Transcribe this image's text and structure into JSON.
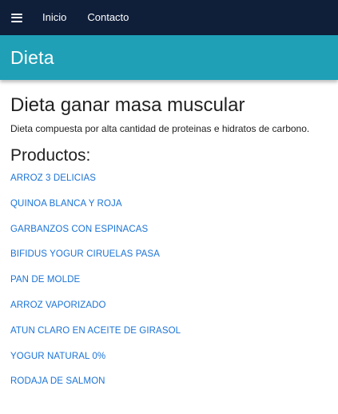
{
  "navbar": {
    "menu_icon": "hamburger-menu-icon",
    "links": [
      "Inicio",
      "Contacto"
    ]
  },
  "banner": {
    "title": "Dieta"
  },
  "main": {
    "title": "Dieta ganar masa muscular",
    "description": "Dieta compuesta por alta cantidad de proteinas e hidratos de carbono.",
    "products_heading": "Productos:",
    "products": [
      "ARROZ 3 DELICIAS",
      "QUINOA BLANCA Y ROJA",
      "GARBANZOS CON ESPINACAS",
      "BIFIDUS YOGUR CIRUELAS PASA",
      "PAN DE MOLDE",
      "ARROZ VAPORIZADO",
      "ATUN CLARO EN ACEITE DE GIRASOL",
      "YOGUR NATURAL 0%",
      "RODAJA DE SALMON"
    ]
  },
  "colors": {
    "navbar_bg": "#0f1f3a",
    "banner_bg": "#1fa0b7",
    "link": "#1a73d6"
  }
}
